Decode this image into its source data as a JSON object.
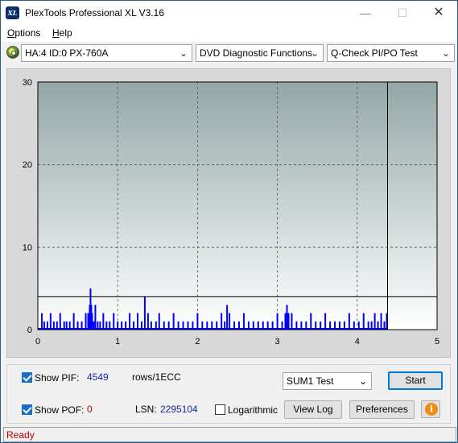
{
  "window": {
    "title": "PlexTools Professional XL V3.16",
    "icon_text": "XL",
    "controls": {
      "minimize": "—",
      "maximize": "☐",
      "close": "✕"
    }
  },
  "menu": {
    "items": [
      {
        "label": "Options",
        "mnemonic": "O",
        "rest": "ptions"
      },
      {
        "label": "Help",
        "mnemonic": "H",
        "rest": "elp"
      }
    ]
  },
  "toolbar": {
    "drive_icon": "disc-drive-icon",
    "drive_select": "HA:4 ID:0  PX-760A",
    "function_select": "DVD Diagnostic Functions",
    "test_select": "Q-Check PI/PO Test",
    "dropdown_glyph": "⌄"
  },
  "chart_data": {
    "type": "bar",
    "title": "",
    "xlabel": "",
    "ylabel": "",
    "xlim": [
      0,
      5
    ],
    "ylim": [
      0,
      30
    ],
    "x_ticks": [
      "0",
      "1",
      "2",
      "3",
      "4",
      "5"
    ],
    "y_ticks": [
      "0",
      "10",
      "20",
      "30"
    ],
    "grid": true,
    "threshold_line": 4,
    "end_marker_x": 4.38,
    "colors": {
      "bars": "#0000ff",
      "plot_bg_top": "#93a7a7",
      "plot_bg_bottom": "#ffffff",
      "threshold": "#000000"
    },
    "series": [
      {
        "x": [
          0.05,
          0.08,
          0.12,
          0.16,
          0.2,
          0.24,
          0.28,
          0.33,
          0.36,
          0.4,
          0.45,
          0.5,
          0.55,
          0.6,
          0.63,
          0.65,
          0.66,
          0.67,
          0.68,
          0.7,
          0.72,
          0.75,
          0.78,
          0.82,
          0.86,
          0.9,
          0.95,
          1.0,
          1.05,
          1.1,
          1.15,
          1.2,
          1.25,
          1.3,
          1.34,
          1.38,
          1.42,
          1.48,
          1.52,
          1.58,
          1.64,
          1.7,
          1.76,
          1.82,
          1.88,
          1.94,
          2.0,
          2.06,
          2.12,
          2.18,
          2.24,
          2.3,
          2.34,
          2.37,
          2.4,
          2.46,
          2.52,
          2.58,
          2.64,
          2.7,
          2.76,
          2.82,
          2.88,
          2.94,
          3.0,
          3.06,
          3.1,
          3.12,
          3.14,
          3.18,
          3.24,
          3.3,
          3.36,
          3.42,
          3.48,
          3.54,
          3.6,
          3.66,
          3.72,
          3.78,
          3.84,
          3.9,
          3.96,
          4.02,
          4.08,
          4.14,
          4.18,
          4.22,
          4.26,
          4.3,
          4.34,
          4.37
        ],
        "values": [
          2,
          1,
          1,
          2,
          1,
          1,
          2,
          1,
          1,
          1,
          2,
          1,
          1,
          2,
          2,
          3,
          5,
          3,
          2,
          1,
          3,
          1,
          1,
          2,
          1,
          1,
          2,
          1,
          1,
          1,
          2,
          1,
          2,
          1,
          4,
          2,
          1,
          1,
          2,
          1,
          1,
          2,
          1,
          1,
          1,
          1,
          2,
          1,
          1,
          1,
          1,
          2,
          1,
          3,
          2,
          1,
          1,
          2,
          1,
          1,
          1,
          1,
          1,
          1,
          2,
          1,
          2,
          3,
          2,
          2,
          1,
          1,
          1,
          2,
          1,
          1,
          2,
          1,
          1,
          1,
          1,
          2,
          1,
          1,
          2,
          1,
          1,
          2,
          1,
          2,
          1,
          2
        ]
      }
    ]
  },
  "controls": {
    "show_pif_label": "Show PIF:",
    "pif_value": "4549",
    "rows_label": "rows/1ECC",
    "show_pof_label": "Show POF:",
    "pof_value": "0",
    "lsn_label": "LSN:",
    "lsn_value": "2295104",
    "logarithmic_label": "Logarithmic",
    "sum_select": "SUM1 Test",
    "start_button": "Start",
    "viewlog_button": "View Log",
    "preferences_button": "Preferences",
    "info_glyph": "i",
    "show_pif_checked": true,
    "show_pof_checked": true,
    "logarithmic_checked": false
  },
  "status": {
    "text": "Ready"
  }
}
